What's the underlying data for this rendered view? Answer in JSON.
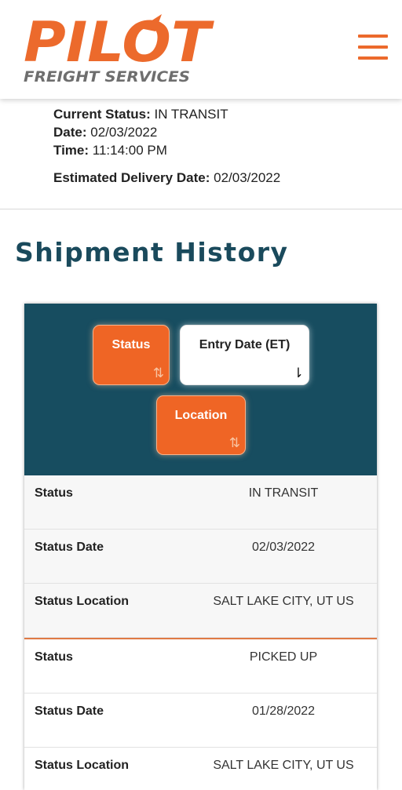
{
  "brand": {
    "name": "PILOT",
    "tagline": "FREIGHT SERVICES"
  },
  "colors": {
    "brand_orange": "#ec6a2c",
    "teal": "#174d60",
    "title": "#1a4a5c"
  },
  "menu": {
    "icon": "hamburger-menu-icon"
  },
  "current": {
    "status_label": "Current Status:",
    "status_value": "IN TRANSIT",
    "date_label": "Date:",
    "date_value": "02/03/2022",
    "time_label": "Time:",
    "time_value": "11:14:00 PM",
    "eta_label": "Estimated Delivery Date:",
    "eta_value": "02/03/2022"
  },
  "history": {
    "title": "Shipment History",
    "sort_buttons": [
      {
        "label": "Status",
        "arrow": "⇅"
      },
      {
        "label": "Entry Date (ET)",
        "arrow": "⇂"
      },
      {
        "label": "Location",
        "arrow": "⇅"
      }
    ],
    "records": [
      {
        "rows": [
          {
            "label": "Status",
            "value": "IN TRANSIT"
          },
          {
            "label": "Status Date",
            "value": "02/03/2022"
          },
          {
            "label": "Status Location",
            "value": "SALT LAKE CITY, UT US"
          }
        ]
      },
      {
        "rows": [
          {
            "label": "Status",
            "value": "PICKED UP"
          },
          {
            "label": "Status Date",
            "value": "01/28/2022"
          },
          {
            "label": "Status Location",
            "value": "SALT LAKE CITY, UT US"
          }
        ]
      }
    ]
  }
}
